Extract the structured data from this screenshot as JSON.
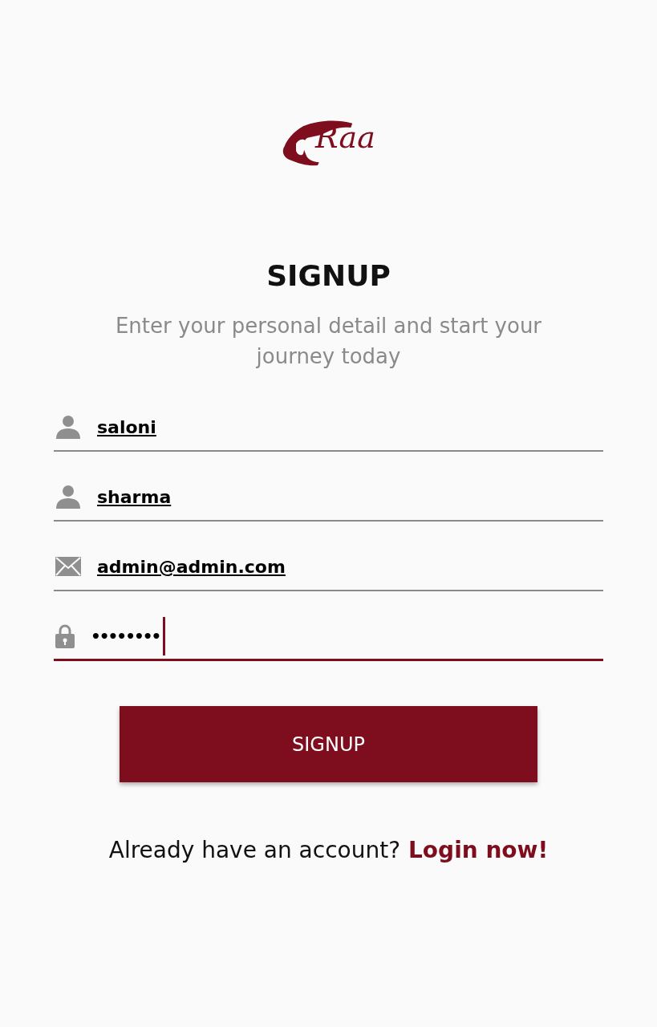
{
  "logo": {
    "text": "Raa"
  },
  "title": "SIGNUP",
  "subtitle": "Enter your personal detail and start your journey today",
  "fields": [
    {
      "kind": "person",
      "value": "saloni",
      "focused": false
    },
    {
      "kind": "person",
      "value": "sharma",
      "focused": false
    },
    {
      "kind": "mail",
      "value": "admin@admin.com",
      "focused": false
    },
    {
      "kind": "lock",
      "value": "••••••••",
      "focused": true
    }
  ],
  "button": "SIGNUP",
  "footer": {
    "text": "Already have an account?",
    "link": "Login now!"
  }
}
